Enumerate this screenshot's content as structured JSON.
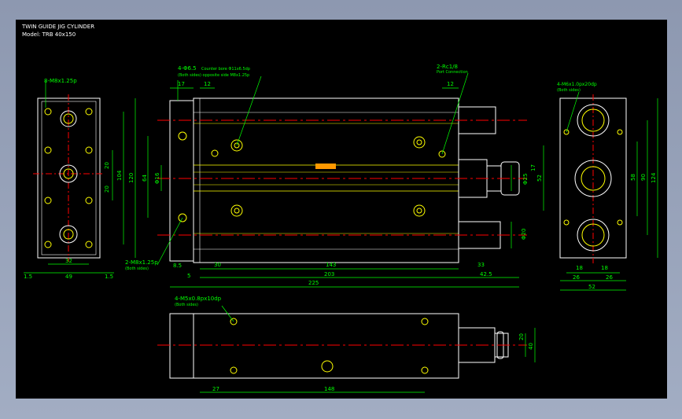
{
  "title": {
    "line1": "TWIN GUIDE JIG CYLINDER",
    "line2": "Model: TRB 40x150"
  },
  "left_view": {
    "note_top": "8-M8x1.25p",
    "dims": {
      "width": "49",
      "side_l": "1.5",
      "side_r": "1.5",
      "inner": "32",
      "v1": "20",
      "v2": "20",
      "v3": "104",
      "v4": "120"
    }
  },
  "front_view": {
    "note_left": "4-Φ6.5",
    "note_main": "Counter bore Φ11x6.5dp",
    "note_sub": "(Both sides) opposite side M8x1.25p",
    "note_rc": "2-Rc1/8",
    "note_rc_sub": "Port Connection",
    "note_lb": "2-M8x1.25p",
    "note_lb_sub": "(Both sides)",
    "dims": {
      "d17": "17",
      "d12a": "12",
      "d12b": "12",
      "d64": "64",
      "phi16": "Φ16",
      "d8_5": "8.5",
      "d5": "5",
      "d30": "30",
      "d143": "143",
      "d33": "33",
      "d203": "203",
      "d42_5": "42.5",
      "d225": "225",
      "phi25": "Φ25",
      "d17r": "17",
      "d52": "52",
      "phi20": "Φ20"
    }
  },
  "right_view": {
    "note_top": "4-M6x1.0px20dp",
    "note_sub": "(Both sides)",
    "dims": {
      "d18a": "18",
      "d18b": "18",
      "d26a": "26",
      "d26b": "26",
      "d52": "52",
      "d58": "58",
      "d90": "90",
      "d124": "124"
    }
  },
  "bottom_view": {
    "note": "4-M5x0.8px10dp",
    "note_sub": "(Both sides)",
    "dims": {
      "d27": "27",
      "d148": "148",
      "d20": "20",
      "d40": "40"
    }
  },
  "colors": {
    "bg": "#000000",
    "outline": "#ffffff",
    "dim": "#00ff00",
    "center": "#ff0000",
    "hole": "#ffff00",
    "accent": "#ff9900"
  }
}
